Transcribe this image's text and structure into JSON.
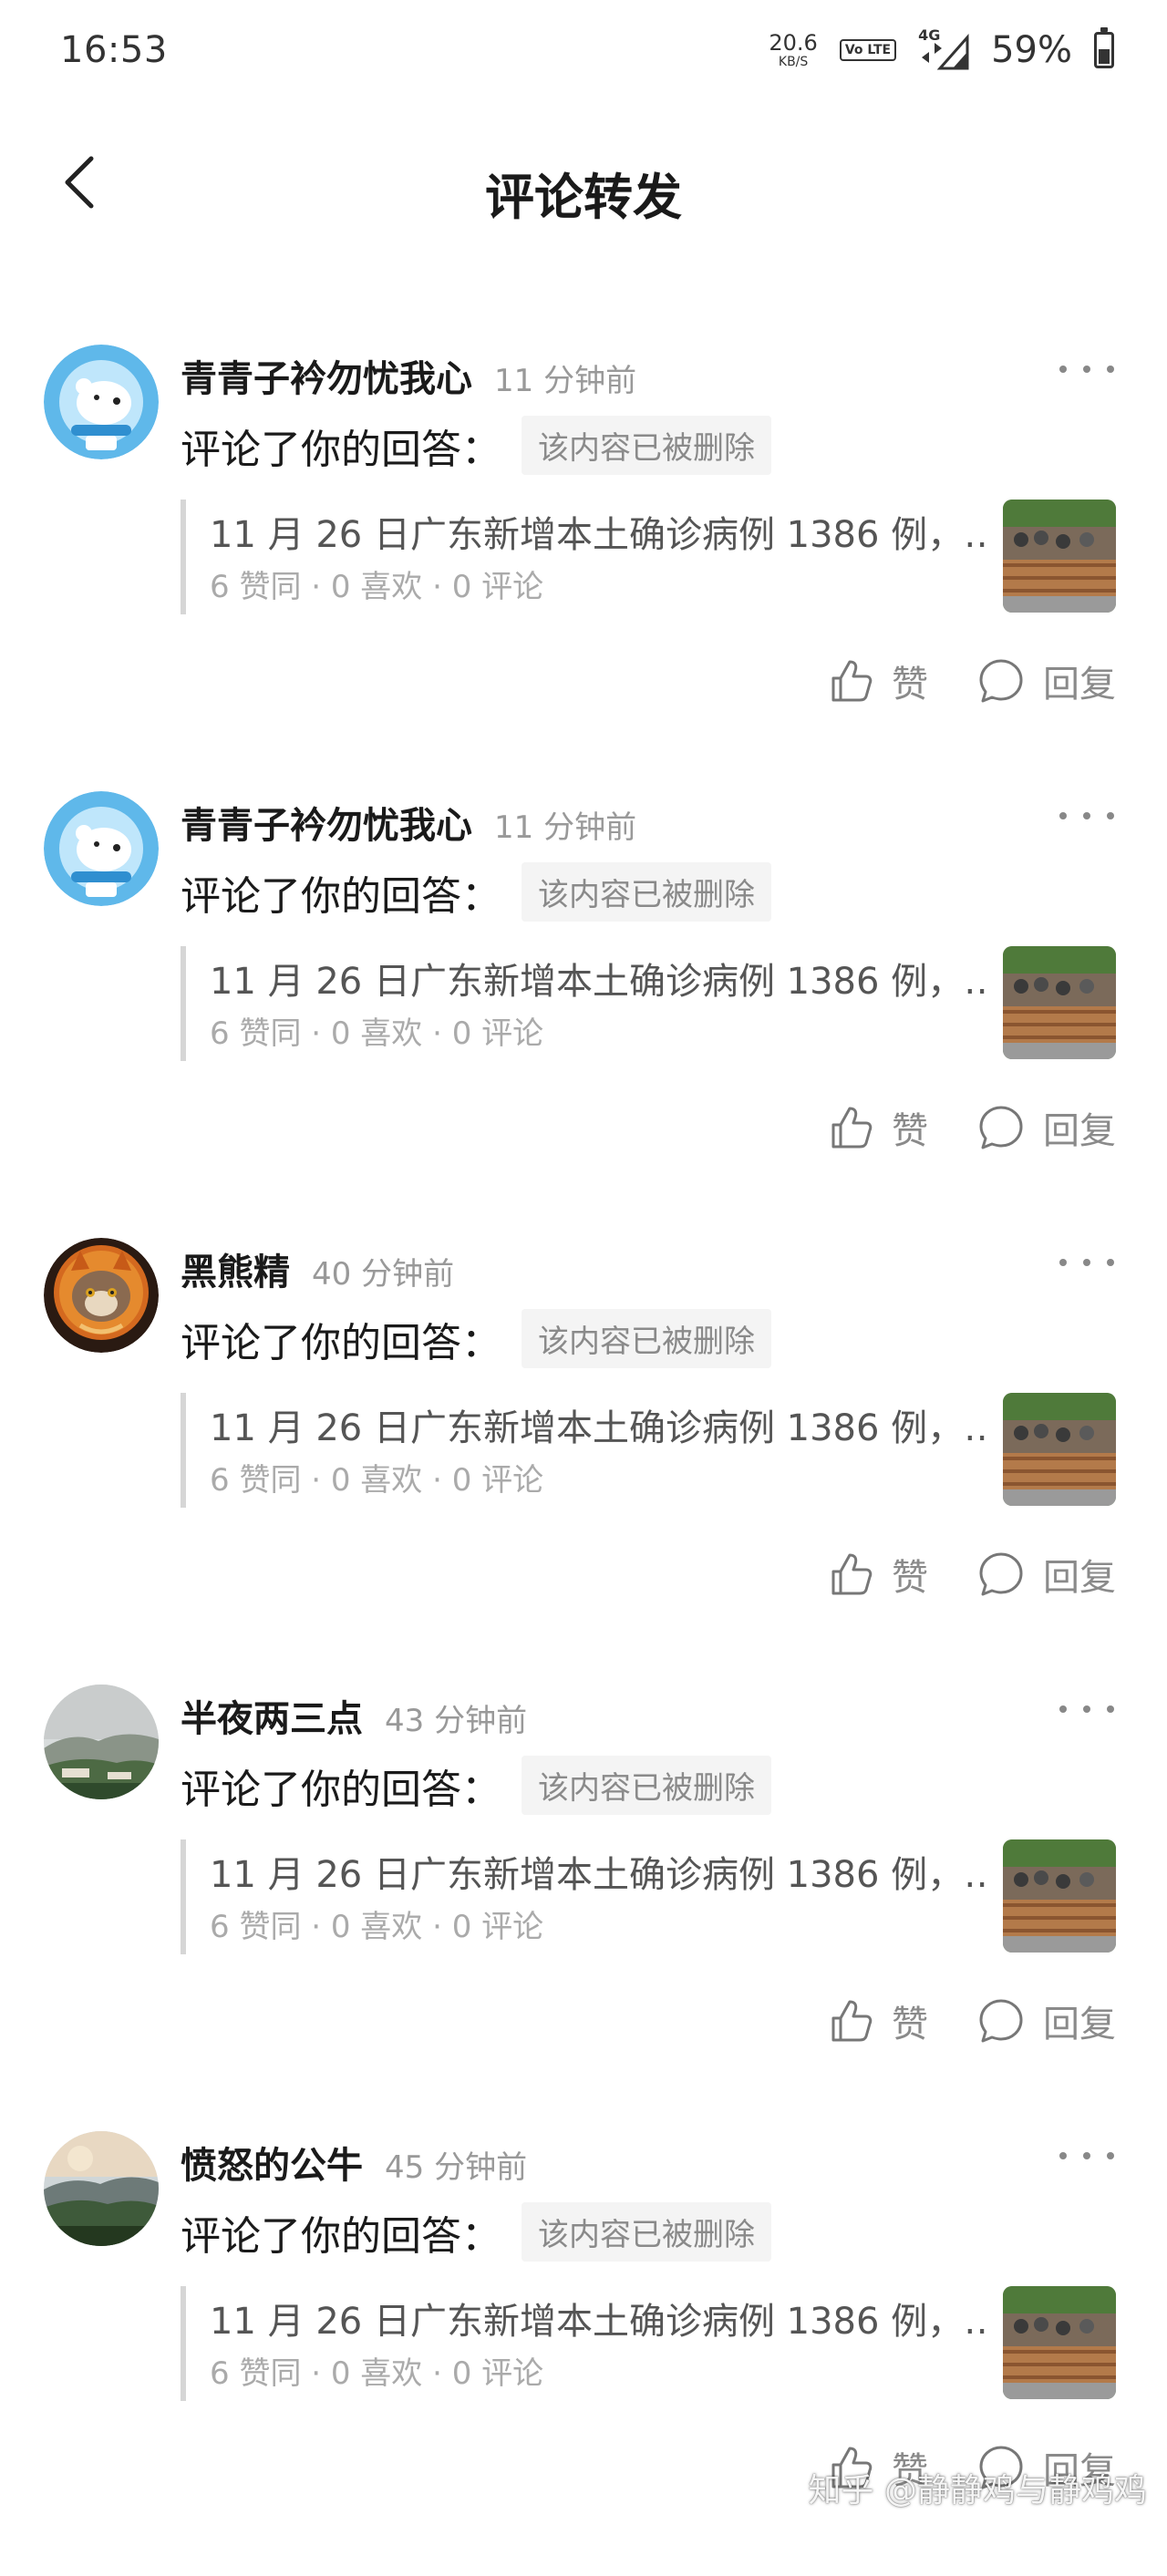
{
  "status_bar": {
    "time": "16:53",
    "net_speed_value": "20.6",
    "net_speed_unit": "KB/S",
    "volte_label": "Vo LTE",
    "network_label": "4G",
    "battery_percent": "59%",
    "battery_level": 0.59
  },
  "header": {
    "title": "评论转发"
  },
  "items": [
    {
      "username": "青青子衿勿忧我心",
      "time": "11 分钟前",
      "action": "评论了你的回答：",
      "deleted_label": "该内容已被删除",
      "quote_title": "11 月 26 日广东新增本土确诊病例 1386 例，…",
      "quote_meta": "6 赞同 · 0 喜欢 · 0 评论",
      "like_label": "赞",
      "reply_label": "回复",
      "avatar_icon": "polar-bear-astronaut-avatar"
    },
    {
      "username": "青青子衿勿忧我心",
      "time": "11 分钟前",
      "action": "评论了你的回答：",
      "deleted_label": "该内容已被删除",
      "quote_title": "11 月 26 日广东新增本土确诊病例 1386 例，…",
      "quote_meta": "6 赞同 · 0 喜欢 · 0 评论",
      "like_label": "赞",
      "reply_label": "回复",
      "avatar_icon": "polar-bear-astronaut-avatar"
    },
    {
      "username": "黑熊精",
      "time": "40 分钟前",
      "action": "评论了你的回答：",
      "deleted_label": "该内容已被删除",
      "quote_title": "11 月 26 日广东新增本土确诊病例 1386 例，…",
      "quote_meta": "6 赞同 · 0 喜欢 · 0 评论",
      "like_label": "赞",
      "reply_label": "回复",
      "avatar_icon": "cat-in-hood-avatar"
    },
    {
      "username": "半夜两三点",
      "time": "43 分钟前",
      "action": "评论了你的回答：",
      "deleted_label": "该内容已被删除",
      "quote_title": "11 月 26 日广东新增本土确诊病例 1386 例，…",
      "quote_meta": "6 赞同 · 0 喜欢 · 0 评论",
      "like_label": "赞",
      "reply_label": "回复",
      "avatar_icon": "misty-mountain-avatar"
    },
    {
      "username": "愤怒的公牛",
      "time": "45 分钟前",
      "action": "评论了你的回答：",
      "deleted_label": "该内容已被删除",
      "quote_title": "11 月 26 日广东新增本土确诊病例 1386 例，…",
      "quote_meta": "6 赞同 · 0 喜欢 · 0 评论",
      "like_label": "赞",
      "reply_label": "回复",
      "avatar_icon": "sunset-mountain-avatar"
    }
  ],
  "watermark": "知乎 @静静鸡与静鸡鸡",
  "colors": {
    "text_primary": "#1a1a1a",
    "text_secondary": "#999999",
    "quote_bar": "#d6d6d6",
    "tag_bg": "#f4f4f4"
  }
}
